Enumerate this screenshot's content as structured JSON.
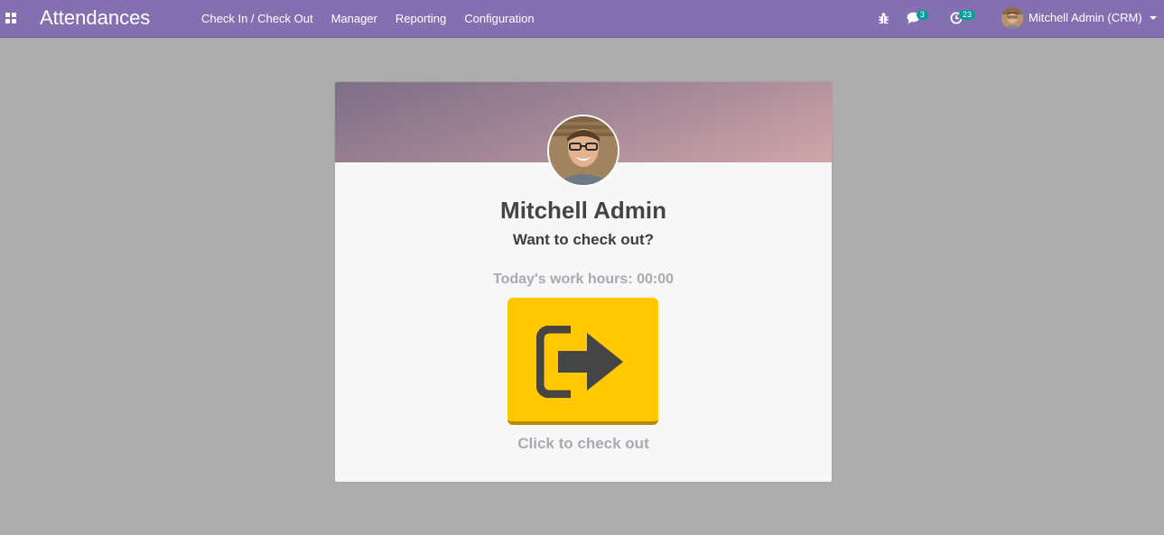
{
  "navbar": {
    "brand": "Attendances",
    "menu": [
      {
        "label": "Check In / Check Out"
      },
      {
        "label": "Manager"
      },
      {
        "label": "Reporting"
      },
      {
        "label": "Configuration"
      }
    ],
    "systray": {
      "debug_icon": "bug-icon",
      "messages_icon": "chat-icon",
      "messages_count": "3",
      "activities_icon": "clock-icon",
      "activities_count": "23",
      "user_name": "Mitchell Admin (CRM)"
    }
  },
  "card": {
    "employee_name": "Mitchell Admin",
    "question": "Want to check out?",
    "work_hours": "Today's work hours: 00:00",
    "button_icon": "sign-out-icon",
    "click_label": "Click to check out"
  },
  "colors": {
    "navbar": "#8470b0",
    "background": "#adadad",
    "button": "#ffc800",
    "badge": "#00a09d"
  }
}
